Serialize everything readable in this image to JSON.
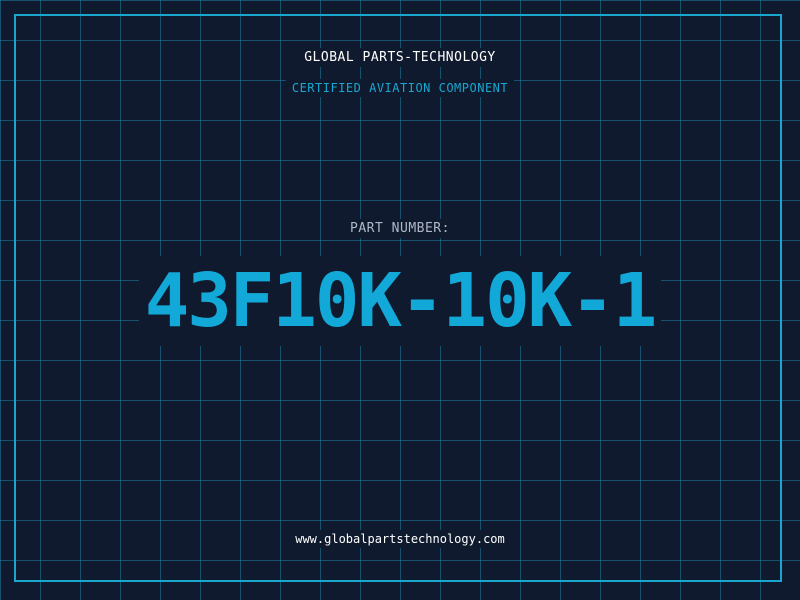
{
  "brand": "GLOBAL PARTS-TECHNOLOGY",
  "subtitle": "CERTIFIED AVIATION COMPONENT",
  "part_label": "PART NUMBER:",
  "part_number": "43F10K-10K-1",
  "website": "www.globalpartstechnology.com",
  "colors": {
    "background": "#101a2e",
    "grid": "#1e96be",
    "accent": "#1aa6cf",
    "text": "#ffffff"
  }
}
